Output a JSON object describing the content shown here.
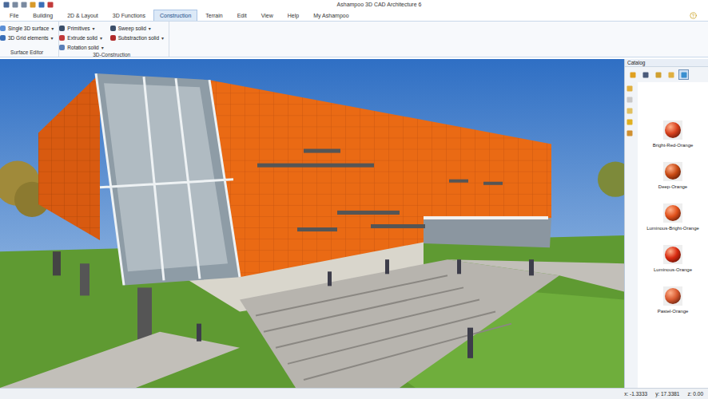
{
  "window": {
    "title": "Ashampoo 3D CAD Architecture 6"
  },
  "tabs": [
    {
      "label": "File",
      "selected": false
    },
    {
      "label": "Building",
      "selected": false
    },
    {
      "label": "2D & Layout",
      "selected": false
    },
    {
      "label": "3D Functions",
      "selected": false
    },
    {
      "label": "Construction",
      "selected": true
    },
    {
      "label": "Terrain",
      "selected": false
    },
    {
      "label": "Edit",
      "selected": false
    },
    {
      "label": "View",
      "selected": false
    },
    {
      "label": "Help",
      "selected": false
    },
    {
      "label": "My Ashampoo",
      "selected": false
    }
  ],
  "ribbon": {
    "caret": "▾",
    "groups": [
      {
        "label": "Surface Editor",
        "columns": [
          [
            {
              "label": "Single 3D surface",
              "color": "#5b8fd6"
            },
            {
              "label": "3D Grid elements",
              "color": "#3a6fb8"
            }
          ]
        ]
      },
      {
        "label": "3D-Construction",
        "columns": [
          [
            {
              "label": "Primitives",
              "color": "#3c4f6a"
            },
            {
              "label": "Extrude solid",
              "color": "#c23a3a"
            },
            {
              "label": "Rotation solid",
              "color": "#5a7fb8"
            }
          ],
          [
            {
              "label": "Sweep solid",
              "color": "#3c4f6a"
            },
            {
              "label": "Substraction solid",
              "color": "#b02a2a"
            }
          ]
        ]
      }
    ]
  },
  "catalog": {
    "title": "Catalog",
    "items": [
      {
        "label": "Bright-Red-Orange",
        "color": "#d8401c"
      },
      {
        "label": "Deep-Orange",
        "color": "#c84a14"
      },
      {
        "label": "Luminous-Bright-Orange",
        "color": "#e0501a"
      },
      {
        "label": "Luminous-Orange",
        "color": "#d82a10"
      },
      {
        "label": "Pastel-Orange",
        "color": "#d85a30"
      }
    ]
  },
  "status_bar": {
    "x": "x: -1.3333",
    "y": "y: 17.3381",
    "z": "z: 0.00"
  }
}
